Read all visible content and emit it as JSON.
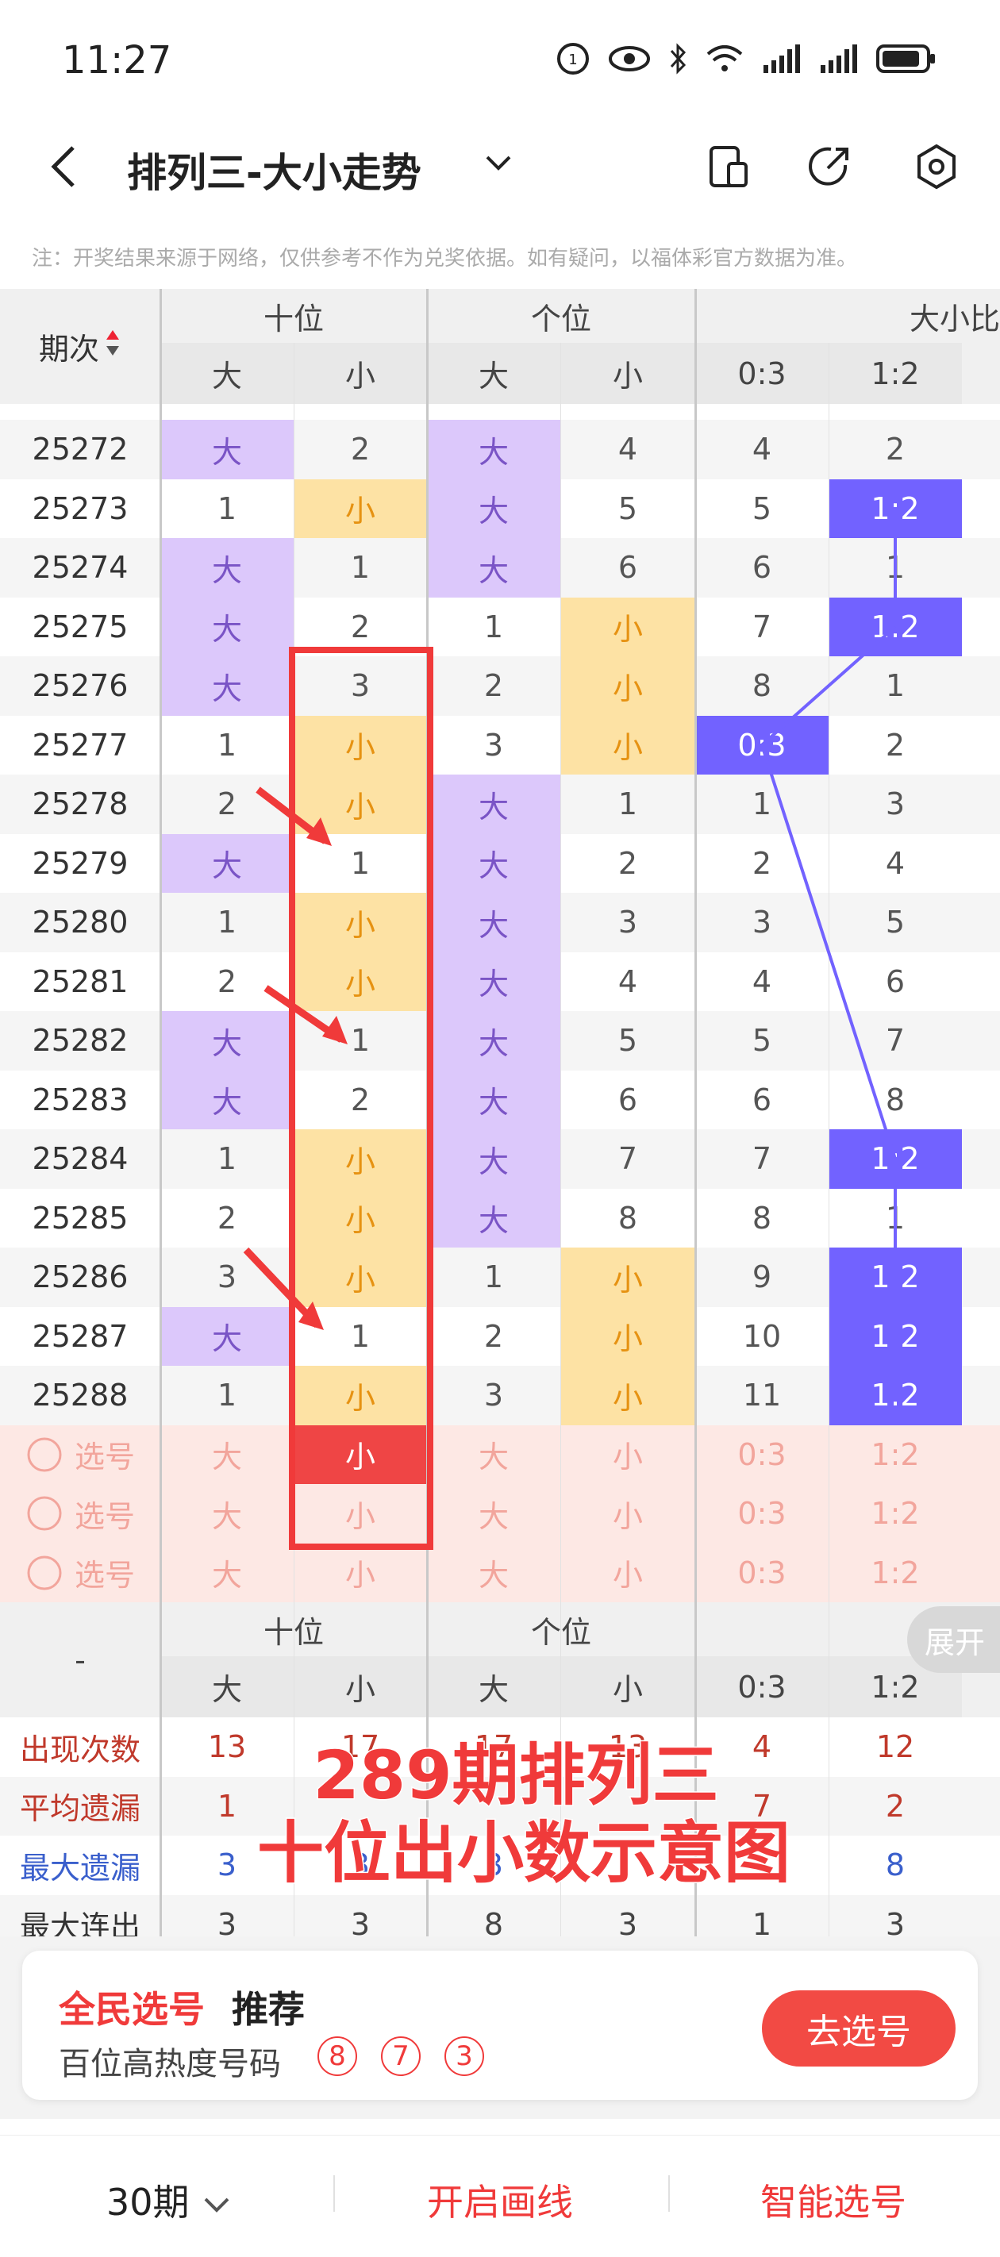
{
  "status": {
    "time": "11:27"
  },
  "title": {
    "text": "排列三-大小走势"
  },
  "notice": "注：开奖结果来源于网络，仅供参考不作为兑奖依据。如有疑问，以福体彩官方数据为准。",
  "header": {
    "issue": "期次",
    "tens": "十位",
    "ones": "个位",
    "ratio_group": "大小比",
    "big": "大",
    "small": "小",
    "r03": "0:3",
    "r12": "1:2"
  },
  "rows": [
    {
      "issue": "25272",
      "t": [
        "B",
        "2"
      ],
      "o": [
        "B",
        "4"
      ],
      "r": [
        "4",
        "2"
      ]
    },
    {
      "issue": "25273",
      "t": [
        "1",
        "S"
      ],
      "o": [
        "B",
        "5"
      ],
      "r": [
        "5",
        "H:1:2"
      ]
    },
    {
      "issue": "25274",
      "t": [
        "B",
        "1"
      ],
      "o": [
        "B",
        "6"
      ],
      "r": [
        "6",
        "1"
      ]
    },
    {
      "issue": "25275",
      "t": [
        "B",
        "2"
      ],
      "o": [
        "1",
        "S"
      ],
      "r": [
        "7",
        "H:1:2"
      ]
    },
    {
      "issue": "25276",
      "t": [
        "B",
        "3"
      ],
      "o": [
        "2",
        "S"
      ],
      "r": [
        "8",
        "1"
      ]
    },
    {
      "issue": "25277",
      "t": [
        "1",
        "S"
      ],
      "o": [
        "3",
        "S"
      ],
      "r": [
        "H:0:3",
        "2"
      ]
    },
    {
      "issue": "25278",
      "t": [
        "2",
        "S"
      ],
      "o": [
        "B",
        "1"
      ],
      "r": [
        "1",
        "3"
      ]
    },
    {
      "issue": "25279",
      "t": [
        "B",
        "1"
      ],
      "o": [
        "B",
        "2"
      ],
      "r": [
        "2",
        "4"
      ]
    },
    {
      "issue": "25280",
      "t": [
        "1",
        "S"
      ],
      "o": [
        "B",
        "3"
      ],
      "r": [
        "3",
        "5"
      ]
    },
    {
      "issue": "25281",
      "t": [
        "2",
        "S"
      ],
      "o": [
        "B",
        "4"
      ],
      "r": [
        "4",
        "6"
      ]
    },
    {
      "issue": "25282",
      "t": [
        "B",
        "1"
      ],
      "o": [
        "B",
        "5"
      ],
      "r": [
        "5",
        "7"
      ]
    },
    {
      "issue": "25283",
      "t": [
        "B",
        "2"
      ],
      "o": [
        "B",
        "6"
      ],
      "r": [
        "6",
        "8"
      ]
    },
    {
      "issue": "25284",
      "t": [
        "1",
        "S"
      ],
      "o": [
        "B",
        "7"
      ],
      "r": [
        "7",
        "H:1:2"
      ]
    },
    {
      "issue": "25285",
      "t": [
        "2",
        "S"
      ],
      "o": [
        "B",
        "8"
      ],
      "r": [
        "8",
        "1"
      ]
    },
    {
      "issue": "25286",
      "t": [
        "3",
        "S"
      ],
      "o": [
        "1",
        "S"
      ],
      "r": [
        "9",
        "H:1:2"
      ]
    },
    {
      "issue": "25287",
      "t": [
        "B",
        "1"
      ],
      "o": [
        "2",
        "S"
      ],
      "r": [
        "10",
        "H:1:2"
      ]
    },
    {
      "issue": "25288",
      "t": [
        "1",
        "S"
      ],
      "o": [
        "3",
        "S"
      ],
      "r": [
        "11",
        "H:1:2"
      ]
    }
  ],
  "pick_label": "选号",
  "stats": {
    "labels": [
      "出现次数",
      "平均遗漏",
      "最大遗漏",
      "最大连出"
    ],
    "values": [
      [
        "13",
        "17",
        "17",
        "13",
        "4",
        "12"
      ],
      [
        "1",
        "",
        "",
        "",
        "7",
        "2"
      ],
      [
        "3",
        "3",
        "3",
        "",
        "",
        "8"
      ],
      [
        "3",
        "3",
        "8",
        "3",
        "1",
        "3"
      ]
    ]
  },
  "stats_dash": "-",
  "overlay": {
    "line1": "289期排列三",
    "line2": "十位出小数示意图"
  },
  "expand": "展开",
  "card": {
    "title_red": "全民选号",
    "title_black": "推荐",
    "sub": "百位高热度号码",
    "balls": [
      "8",
      "7",
      "3"
    ],
    "button": "去选号"
  },
  "bottom": {
    "period": "30期",
    "draw": "开启画线",
    "smart": "智能选号"
  },
  "colors": {
    "accent": "#f03a3a",
    "big": "#dcc8fb",
    "small": "#fde2a4",
    "ratio": "#7262ff"
  }
}
